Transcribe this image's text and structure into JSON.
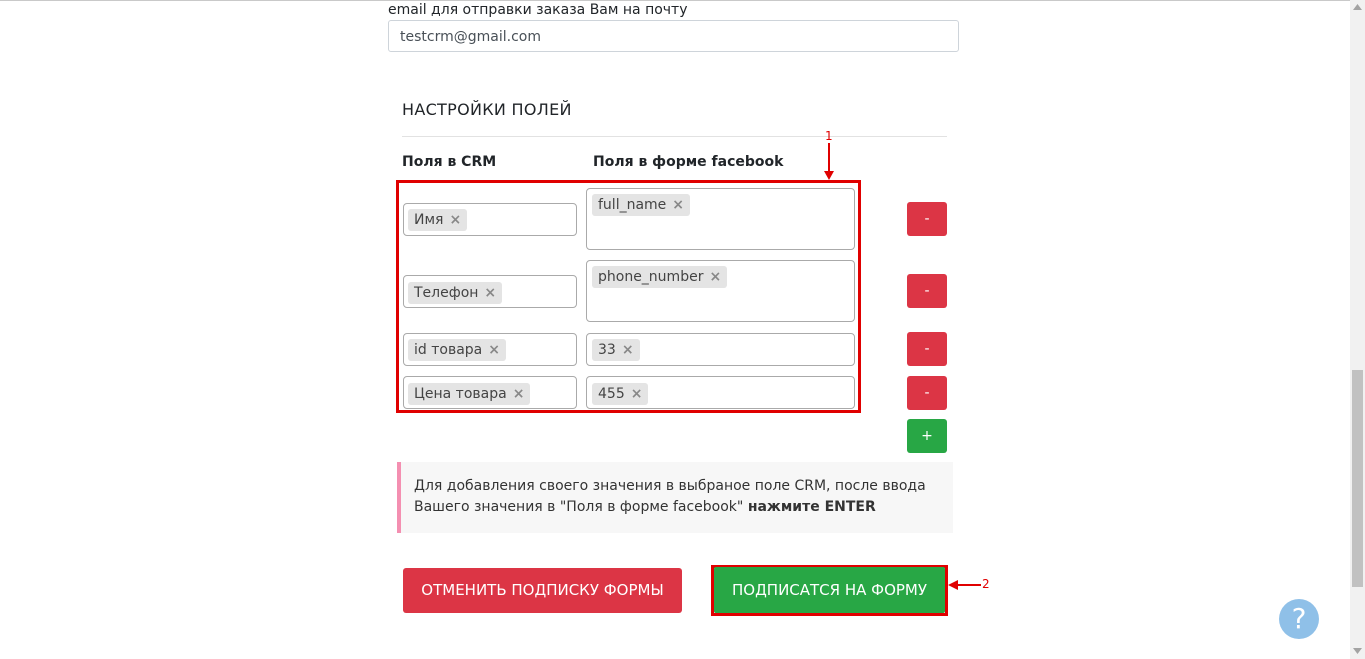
{
  "email": {
    "label": "email для отправки заказа Вам на почту",
    "value": "testcrm@gmail.com"
  },
  "fields_settings": {
    "title": "НАСТРОЙКИ ПОЛЕЙ",
    "col_crm": "Поля в CRM",
    "col_facebook": "Поля в форме facebook",
    "rows": [
      {
        "crm": "Имя",
        "facebook": "full_name",
        "remove": "-"
      },
      {
        "crm": "Телефон",
        "facebook": "phone_number",
        "remove": "-"
      },
      {
        "crm": "id товара",
        "facebook": "33",
        "remove": "-"
      },
      {
        "crm": "Цена товара",
        "facebook": "455",
        "remove": "-"
      }
    ],
    "add": "+",
    "chip_remove": "×"
  },
  "note": {
    "text": "Для добавления своего значения в выбраное поле CRM, после ввода Вашего значения в \"Поля в форме facebook\"",
    "bold": "нажмите ENTER"
  },
  "buttons": {
    "cancel": "ОТМЕНИТЬ ПОДПИСКУ ФОРМЫ",
    "subscribe": "ПОДПИСАТСЯ НА ФОРМУ"
  },
  "annotations": {
    "marker1": "1",
    "marker2": "2"
  },
  "help": {
    "icon": "?"
  },
  "colors": {
    "danger": "#dc3545",
    "success": "#28a745",
    "annotation": "#e00000"
  }
}
